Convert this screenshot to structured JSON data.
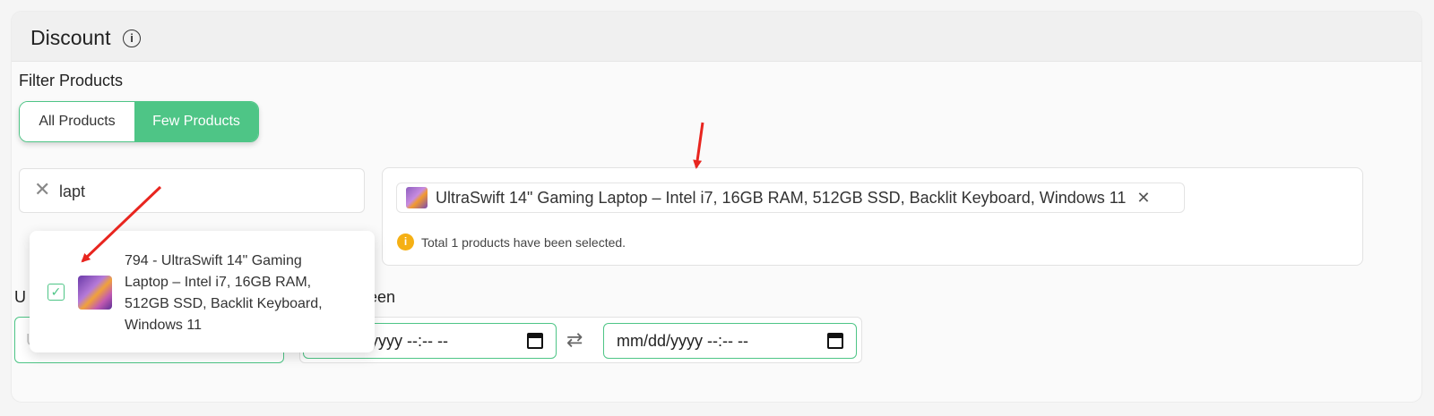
{
  "card": {
    "title": "Discount"
  },
  "filter": {
    "label": "Filter Products",
    "options": [
      "All Products",
      "Few Products"
    ],
    "selected": "Few Products"
  },
  "search": {
    "value": "lapt"
  },
  "results": [
    {
      "text": "794 - UltraSwift 14\" Gaming Laptop – Intel i7, 16GB RAM, 512GB SSD, Backlit Keyboard, Windows 11",
      "checked": true
    }
  ],
  "selected": {
    "chips": [
      {
        "label": "UltraSwift 14\" Gaming Laptop – Intel i7, 16GB RAM, 512GB SSD, Backlit Keyboard, Windows 11"
      }
    ],
    "note": "Total 1 products have been selected."
  },
  "limit": {
    "label_visible": "U",
    "placeholder": "Unlimited"
  },
  "between": {
    "label_visible": "ween"
  },
  "dates": {
    "start": "mm/dd/yyyy --:-- --",
    "end": "mm/dd/yyyy --:-- --"
  },
  "colors": {
    "accent": "#4ec586",
    "annotation": "#e8251f",
    "warning": "#f5b014"
  }
}
